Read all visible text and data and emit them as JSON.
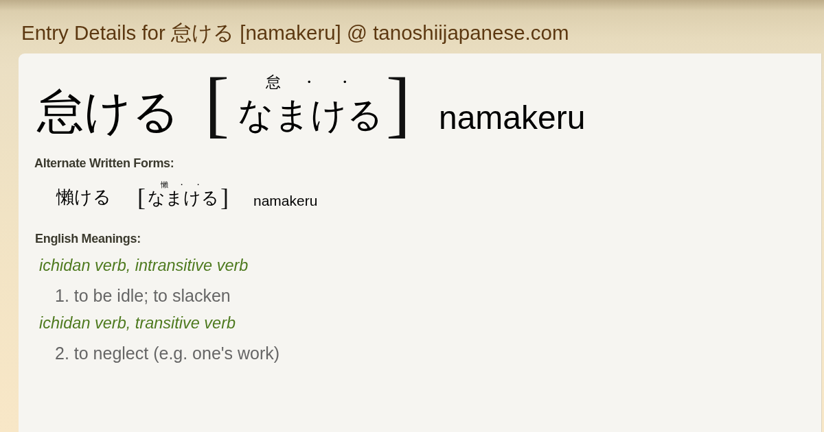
{
  "title": "Entry Details for 怠ける [namakeru] @ tanoshiijapanese.com",
  "entry": {
    "written": "怠ける",
    "open_bracket": "[",
    "furigana": [
      "怠",
      "・",
      "・"
    ],
    "reading": "なまける",
    "close_bracket": "]",
    "romaji": "namakeru"
  },
  "alternate_forms": {
    "label": "Alternate Written Forms:",
    "forms": [
      {
        "written": "懶ける",
        "open_bracket": "[",
        "furigana": [
          "懶",
          "・",
          "・"
        ],
        "reading": "なまける",
        "close_bracket": "]",
        "romaji": "namakeru"
      }
    ]
  },
  "english_meanings": {
    "label": "English Meanings:",
    "senses": [
      {
        "part_of_speech": "ichidan verb, intransitive verb",
        "meaning": "1. to be idle; to slacken"
      },
      {
        "part_of_speech": "ichidan verb, transitive verb",
        "meaning": "2. to neglect (e.g. one's work)"
      }
    ]
  }
}
